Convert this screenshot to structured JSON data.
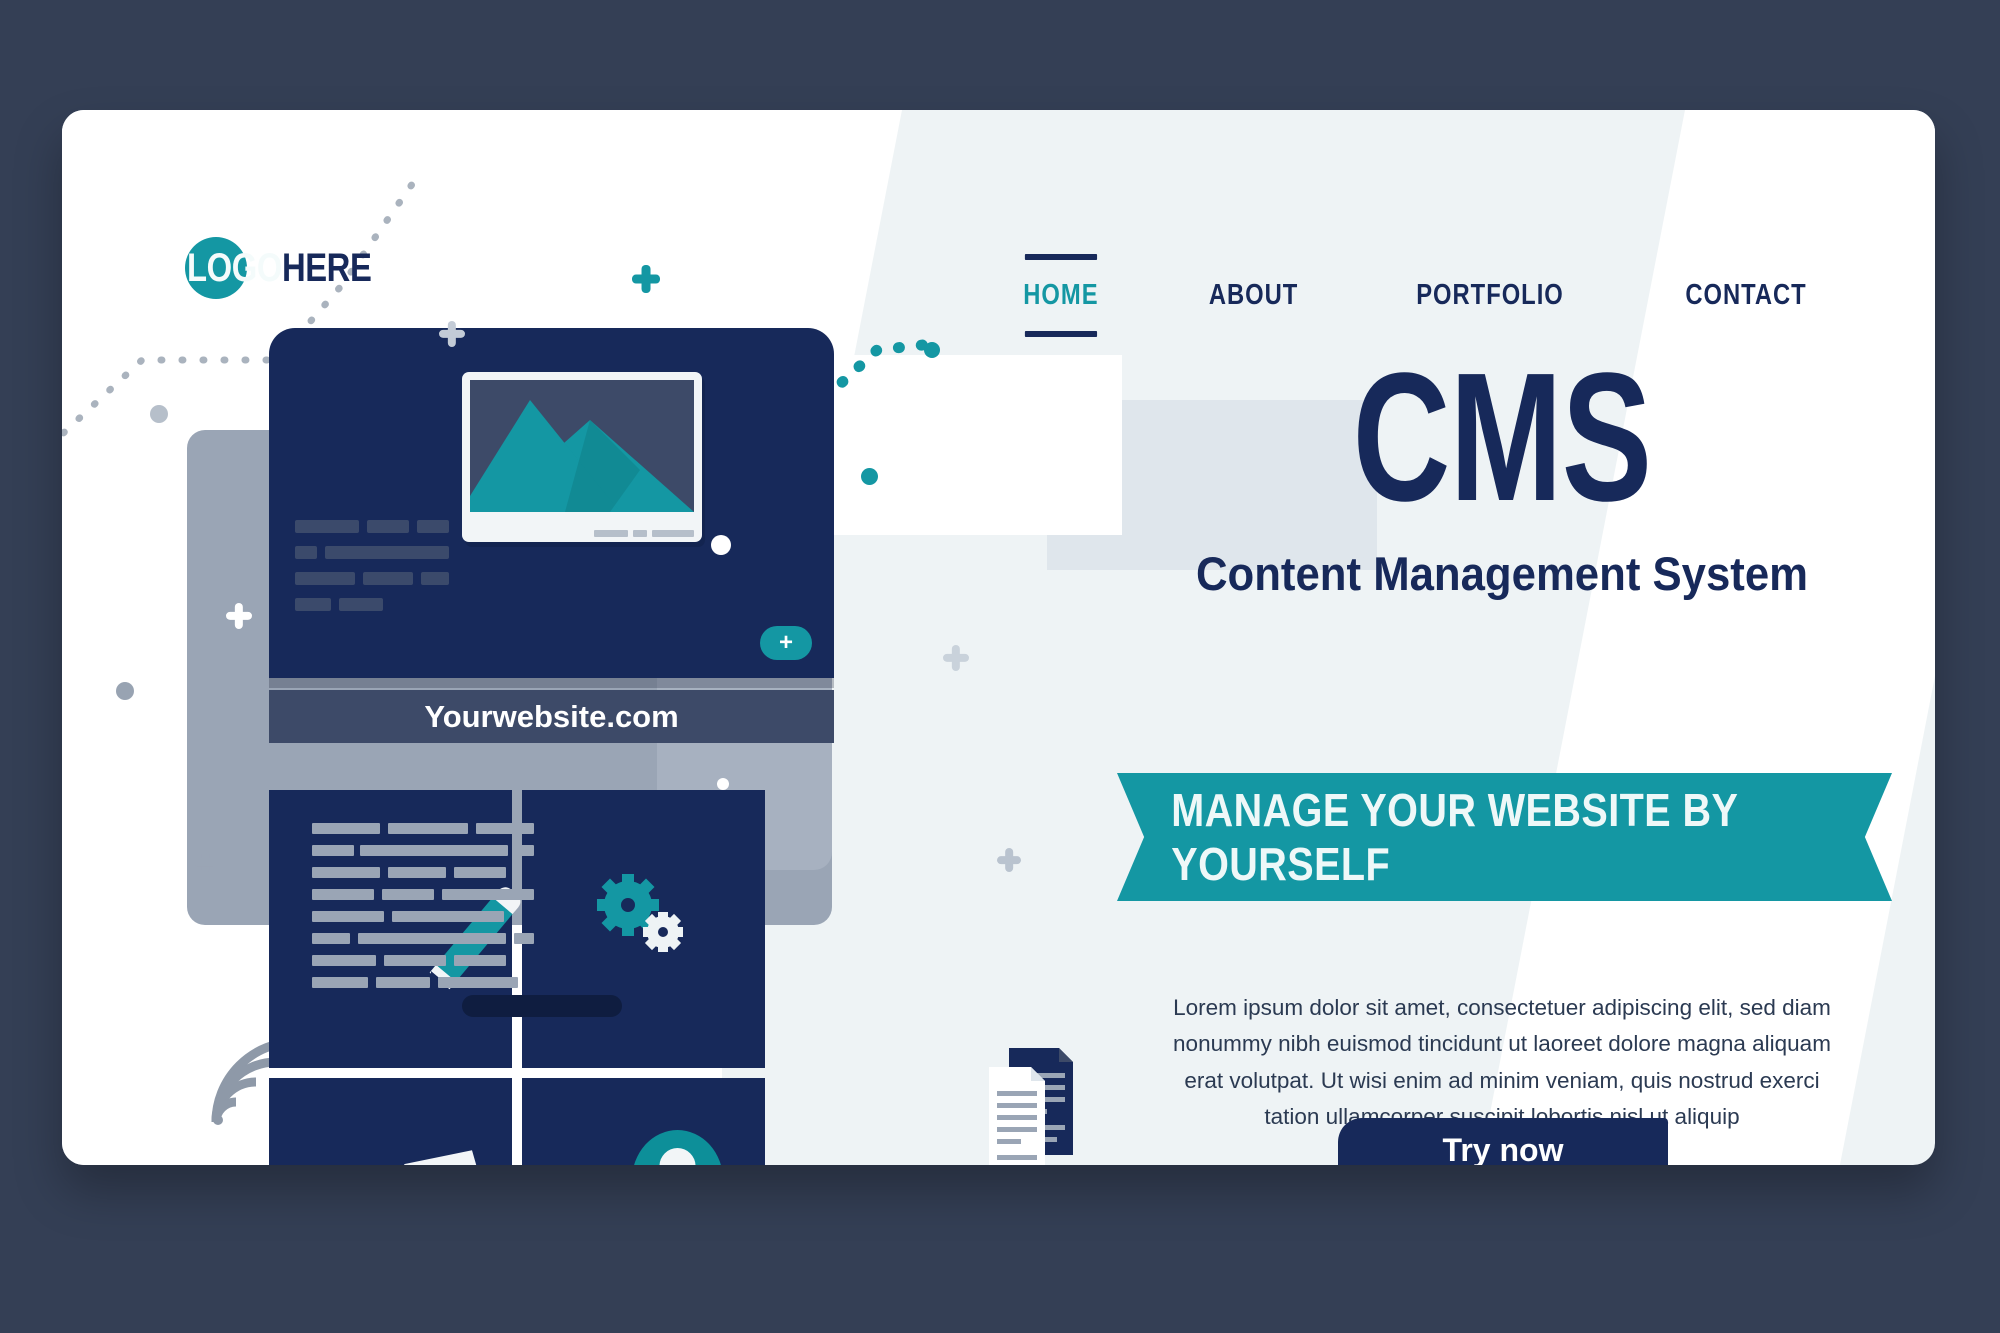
{
  "page": {
    "background_color": "#343f55",
    "card_color": "#eef3f5"
  },
  "header": {
    "logo": {
      "circle_color": "#1497a3",
      "part_a": "LOGO",
      "part_b": "HERE"
    },
    "nav": [
      {
        "label": "HOME",
        "active": true
      },
      {
        "label": "ABOUT",
        "active": false
      },
      {
        "label": "PORTFOLIO",
        "active": false
      },
      {
        "label": "CONTACT",
        "active": false
      }
    ]
  },
  "hero": {
    "title": "CMS",
    "subtitle": "Content Management System",
    "ribbon_label": "MANAGE YOUR WEBSITE BY YOURSELF",
    "ribbon_color": "#1497a3",
    "body": "Lorem ipsum dolor sit amet, consectetuer adipiscing elit, sed diam nonummy nibh euismod tincidunt ut laoreet dolore magna aliquam erat volutpat. Ut wisi enim ad minim veniam, quis nostrud exerci tation ullamcorper suscipit lobortis nisl ut aliquip",
    "cta_label": "Try now",
    "cta_color": "#17295a"
  },
  "illustration": {
    "url_label": "Yourwebsite.com",
    "add_button_label": "+",
    "status_pills": [
      "#e8294d",
      "#f07d1a",
      "#1497a3"
    ],
    "colors": {
      "navy": "#17295a",
      "teal": "#1497a3",
      "grey_panel": "#9aa5b5",
      "slate": "#3d4a68"
    },
    "icons": [
      "image-placeholder-icon",
      "pencil-icon",
      "gears-icon",
      "folder-icon",
      "user-avatar-icon",
      "documents-icon",
      "signal-arcs-icon",
      "cloud-icon"
    ]
  }
}
